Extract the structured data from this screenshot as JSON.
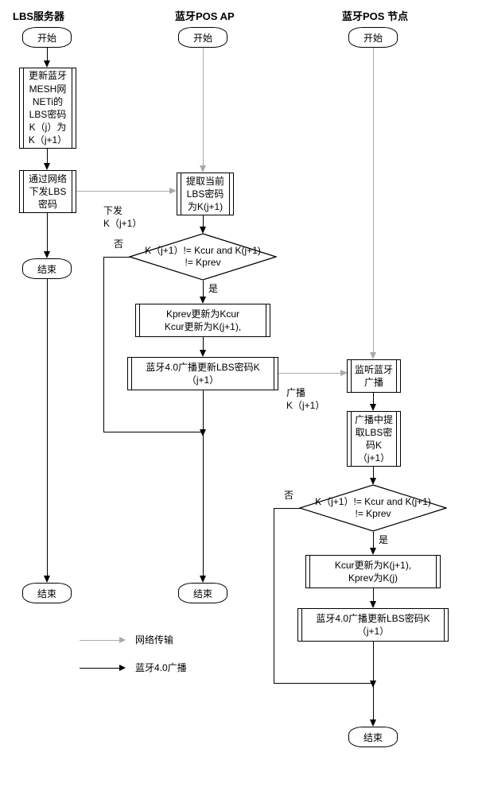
{
  "columns": {
    "c1_title": "LBS服务器",
    "c2_title": "蓝牙POS AP",
    "c3_title": "蓝牙POS 节点"
  },
  "c1": {
    "start": "开始",
    "p1": "更新蓝牙\nMESH网\nNETi的\nLBS密码\nK（j）为\nK（j+1）",
    "p2": "通过网络\n下发LBS\n密码",
    "end1": "结束",
    "end2": "结束"
  },
  "c2": {
    "start": "开始",
    "p1": "提取当前\nLBS密码\n为K(j+1)",
    "d1": "K（j+1）!= Kcur and  K(j+1)\n!= Kprev",
    "p2": "Kprev更新为Kcur\nKcur更新为K(j+1),",
    "p3": "蓝牙4.0广播更新LBS密码K\n（j+1）",
    "end": "结束"
  },
  "c3": {
    "start": "开始",
    "p1": "监听蓝牙\n广播",
    "p2": "广播中提\n取LBS密\n码K\n（j+1）",
    "d1": "K（j+1）!= Kcur and  K(j+1)\n!= Kprev",
    "p3": "Kcur更新为K(j+1),\nKprev为K(j)",
    "p4": "蓝牙4.0广播更新LBS密码K\n（j+1）",
    "end": "结束"
  },
  "labels": {
    "send_k": "下发\nK（j+1）",
    "broadcast_k": "广播\nK（j+1）",
    "yes": "是",
    "no": "否"
  },
  "legend": {
    "network": "网络传输",
    "bt": "蓝牙4.0广播"
  }
}
